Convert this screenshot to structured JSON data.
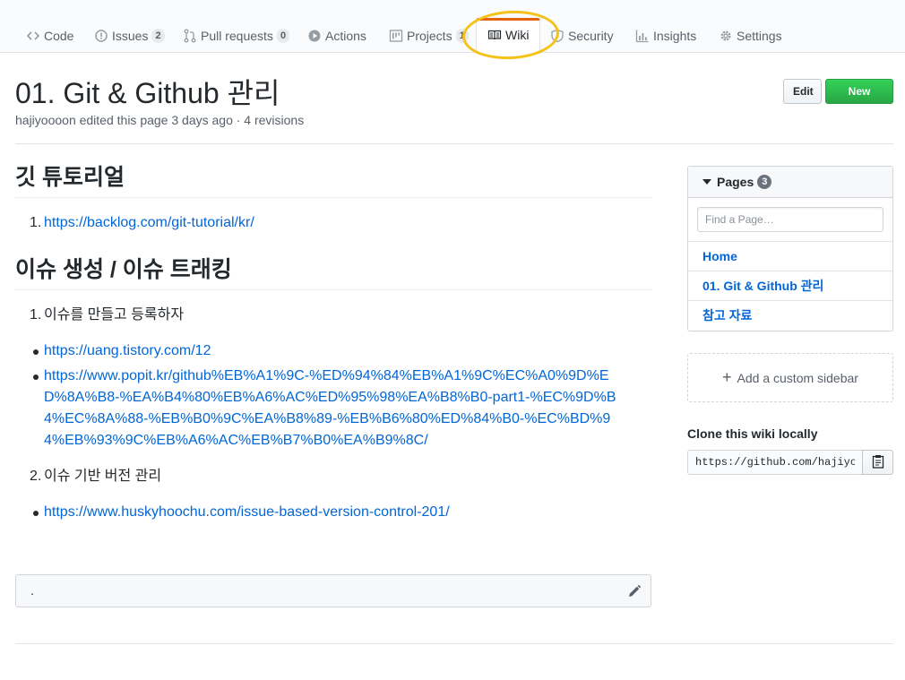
{
  "tabs": [
    {
      "label": "Code",
      "icon": "code-icon"
    },
    {
      "label": "Issues",
      "icon": "issue-icon",
      "count": "2"
    },
    {
      "label": "Pull requests",
      "icon": "pull-request-icon",
      "count": "0"
    },
    {
      "label": "Actions",
      "icon": "play-icon"
    },
    {
      "label": "Projects",
      "icon": "project-icon",
      "count": "1"
    },
    {
      "label": "Wiki",
      "icon": "book-icon",
      "selected": true
    },
    {
      "label": "Security",
      "icon": "shield-icon"
    },
    {
      "label": "Insights",
      "icon": "graph-icon"
    },
    {
      "label": "Settings",
      "icon": "gear-icon"
    }
  ],
  "header": {
    "title": "01. Git & Github 관리",
    "meta": "hajiyoooon edited this page 3 days ago · 4 revisions",
    "edit_label": "Edit",
    "new_page_label": "New Page"
  },
  "content": {
    "section1": {
      "heading": "깃 튜토리얼",
      "items": [
        {
          "num": "1.",
          "text": "https://backlog.com/git-tutorial/kr/"
        }
      ]
    },
    "section2": {
      "heading": "이슈 생성 / 이슈 트래킹",
      "item1": {
        "num": "1.",
        "text": "이슈를 만들고 등록하자"
      },
      "links1": [
        "https://uang.tistory.com/12",
        "https://www.popit.kr/github%EB%A1%9C-%ED%94%84%EB%A1%9C%EC%A0%9D%ED%8A%B8-%EA%B4%80%EB%A6%AC%ED%95%98%EA%B8%B0-part1-%EC%9D%B4%EC%8A%88-%EB%B0%9C%EA%B8%89-%EB%B6%80%ED%84%B0-%EC%BD%94%EB%93%9C%EB%A6%AC%EB%B7%B0%EA%B9%8C/"
      ],
      "item2": {
        "num": "2.",
        "text": "이슈 기반 버전 관리"
      },
      "links2": [
        "https://www.huskyhoochu.com/issue-based-version-control-201/"
      ]
    },
    "footer_text": "."
  },
  "sidebar": {
    "pages_label": "Pages",
    "pages_count": "3",
    "filter_placeholder": "Find a Page…",
    "pages": [
      "Home",
      "01. Git & Github 관리",
      "참고 자료"
    ],
    "custom_sidebar_label": "Add a custom sidebar",
    "clone_title": "Clone this wiki locally",
    "clone_url": "https://github.com/hajiyoooon/git-study.wiki.git"
  },
  "colors": {
    "link": "#0366d6",
    "selected_tab_accent": "#e36209",
    "new_page_button": "#28a745",
    "highlight_circle": "#f5c21a"
  }
}
